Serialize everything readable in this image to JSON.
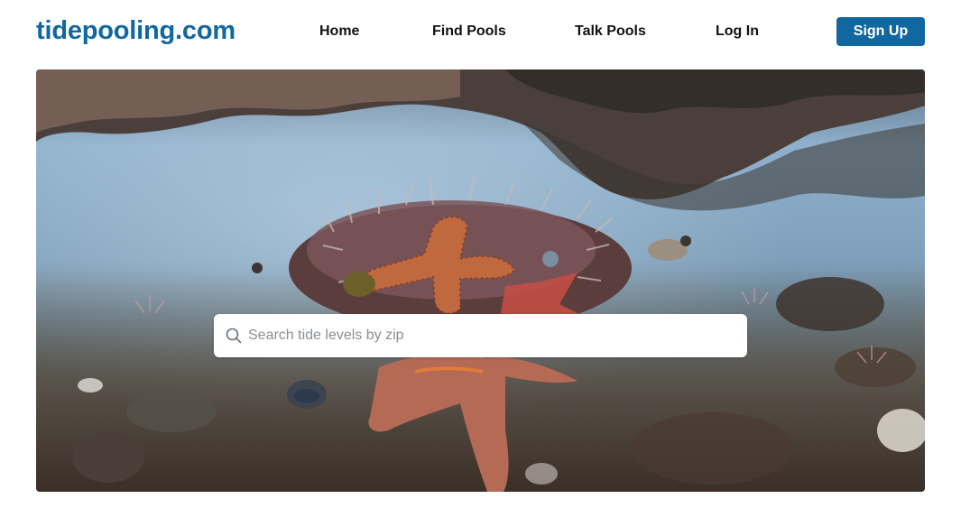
{
  "brand": {
    "name": "tidepooling.com",
    "color": "#1167a0"
  },
  "nav": {
    "home": "Home",
    "find_pools": "Find Pools",
    "talk_pools": "Talk Pools",
    "log_in": "Log In",
    "sign_up": "Sign Up"
  },
  "hero": {
    "image": "tide-pool-sea-star-photo",
    "search": {
      "icon": "search-icon",
      "placeholder": "Search tide levels by zip",
      "value": ""
    }
  }
}
